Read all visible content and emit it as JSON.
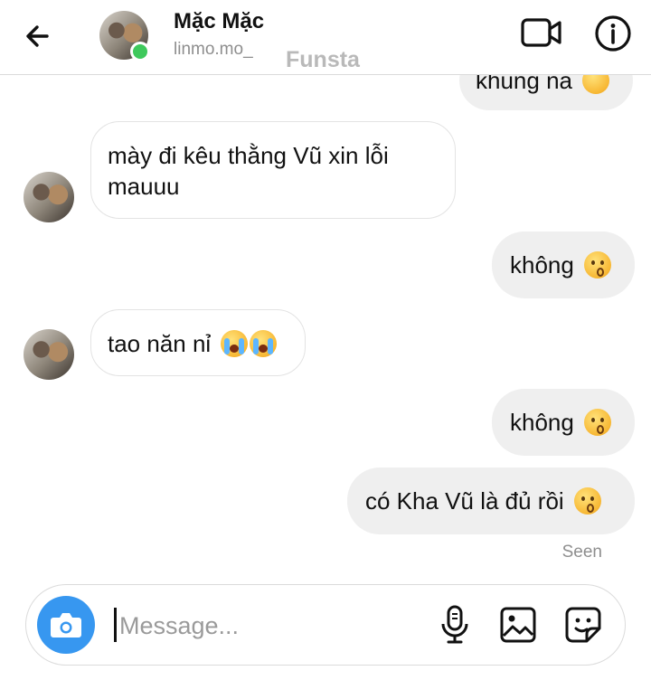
{
  "header": {
    "contact_name": "Mặc Mặc",
    "username": "linmo.mo_",
    "overlay_label": "Funsta"
  },
  "messages": [
    {
      "direction": "outgoing",
      "text": "khung na",
      "emoji": "thinking-face"
    },
    {
      "direction": "incoming",
      "lines": [
        "mày đi kêu thằng Vũ xin lỗi",
        "mauuu"
      ]
    },
    {
      "direction": "outgoing",
      "text": "không",
      "emoji": "kissing-face"
    },
    {
      "direction": "incoming",
      "text": "tao năn nỉ",
      "emoji": "loudly-crying-face x2"
    },
    {
      "direction": "outgoing",
      "text": "không",
      "emoji": "kissing-face"
    },
    {
      "direction": "outgoing",
      "text": "có Kha Vũ là đủ rồi",
      "emoji": "kissing-face"
    }
  ],
  "status": {
    "seen": "Seen"
  },
  "composer": {
    "placeholder": "Message..."
  },
  "icons": [
    "back-arrow-icon",
    "video-camera-icon",
    "info-icon",
    "camera-icon",
    "microphone-icon",
    "gallery-icon",
    "sticker-icon"
  ],
  "colors": {
    "accent": "#3797f0",
    "online": "#3ec95c",
    "outgoing_bubble": "#efefef",
    "muted_text": "#8e8e8e"
  }
}
